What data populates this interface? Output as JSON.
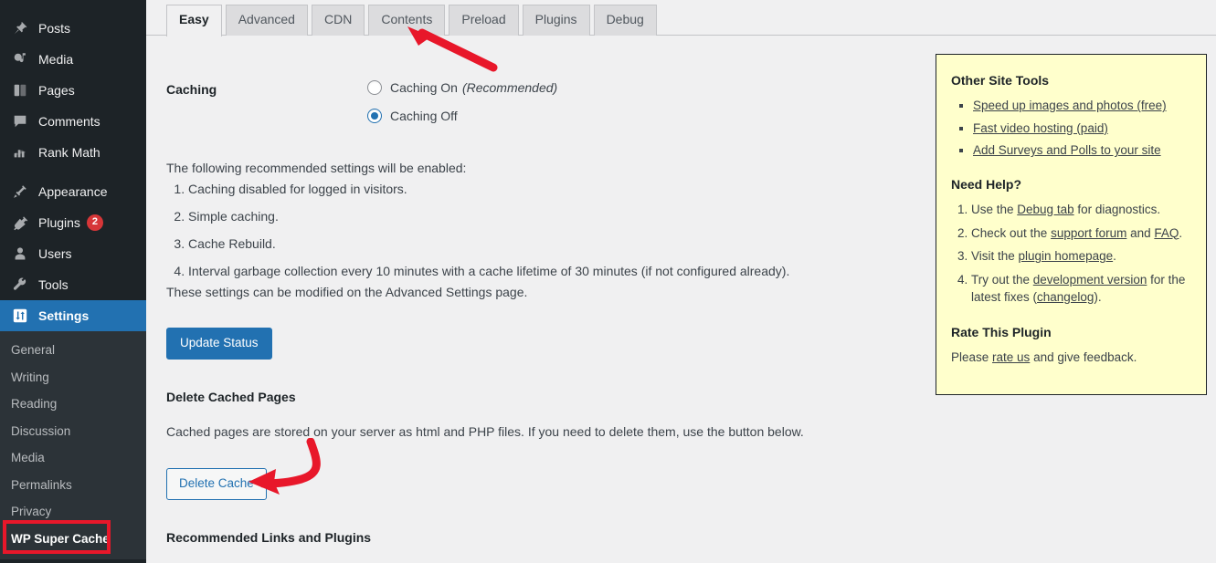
{
  "sidebar": {
    "items": [
      {
        "label": "Posts",
        "icon": "pin-icon",
        "type": "item"
      },
      {
        "label": "Media",
        "icon": "media-icon",
        "type": "item"
      },
      {
        "label": "Pages",
        "icon": "pages-icon",
        "type": "item"
      },
      {
        "label": "Comments",
        "icon": "comment-icon",
        "type": "item"
      },
      {
        "label": "Rank Math",
        "icon": "chart-bars-icon",
        "type": "item"
      },
      {
        "label": "",
        "icon": "",
        "type": "separator"
      },
      {
        "label": "Appearance",
        "icon": "brush-icon",
        "type": "item"
      },
      {
        "label": "Plugins",
        "icon": "plug-icon",
        "type": "item",
        "badge": "2"
      },
      {
        "label": "Users",
        "icon": "user-icon",
        "type": "item"
      },
      {
        "label": "Tools",
        "icon": "wrench-icon",
        "type": "item"
      },
      {
        "label": "Settings",
        "icon": "sliders-icon",
        "type": "item",
        "current": true
      }
    ],
    "submenu": [
      {
        "label": "General"
      },
      {
        "label": "Writing"
      },
      {
        "label": "Reading"
      },
      {
        "label": "Discussion"
      },
      {
        "label": "Media"
      },
      {
        "label": "Permalinks"
      },
      {
        "label": "Privacy"
      },
      {
        "label": "WP Super Cache",
        "current": true
      }
    ],
    "colors": {
      "background": "#1d2327",
      "submenu_background": "#2c3338",
      "current_item": "#2271b1",
      "badge": "#d63638",
      "highlight_outline": "#e8172a"
    }
  },
  "tabs": [
    {
      "label": "Easy",
      "active": true
    },
    {
      "label": "Advanced",
      "active": false
    },
    {
      "label": "CDN",
      "active": false
    },
    {
      "label": "Contents",
      "active": false
    },
    {
      "label": "Preload",
      "active": false
    },
    {
      "label": "Plugins",
      "active": false
    },
    {
      "label": "Debug",
      "active": false
    }
  ],
  "caching": {
    "section_label": "Caching",
    "option_on": "Caching On",
    "option_on_note": "(Recommended)",
    "option_off": "Caching Off",
    "selected": "Caching Off",
    "intro": "The following recommended settings will be enabled:",
    "recommended": [
      "Caching disabled for logged in visitors.",
      "Simple caching.",
      "Cache Rebuild.",
      "Interval garbage collection every 10 minutes with a cache lifetime of 30 minutes (if not configured already)."
    ],
    "modify_note": "These settings can be modified on the Advanced Settings page.",
    "update_button": "Update Status"
  },
  "delete_cache": {
    "heading": "Delete Cached Pages",
    "description": "Cached pages are stored on your server as html and PHP files. If you need to delete them, use the button below.",
    "button": "Delete Cache"
  },
  "recommended_links_heading": "Recommended Links and Plugins",
  "side_box": {
    "tools_heading": "Other Site Tools",
    "tools": [
      "Speed up images and photos (free)",
      "Fast video hosting (paid)",
      "Add Surveys and Polls to your site"
    ],
    "help_heading": "Need Help?",
    "help": [
      {
        "prefix": "Use the ",
        "link": "Debug tab",
        "suffix": " for diagnostics."
      },
      {
        "prefix": "Check out the ",
        "link": "support forum",
        "mid": " and ",
        "link2": "FAQ",
        "suffix": "."
      },
      {
        "prefix": "Visit the ",
        "link": "plugin homepage",
        "suffix": "."
      },
      {
        "prefix": "Try out the ",
        "link": "development version",
        "mid": " for the latest fixes (",
        "link2": "changelog",
        "suffix": ")."
      }
    ],
    "rate_heading": "Rate This Plugin",
    "rate_prefix": "Please ",
    "rate_link": "rate us",
    "rate_suffix": " and give feedback.",
    "background": "#ffffcc"
  },
  "annotations": {
    "arrow_color": "#e8172a",
    "arrow_contents_target": "Contents",
    "arrow_delete_target": "Delete Cache"
  }
}
